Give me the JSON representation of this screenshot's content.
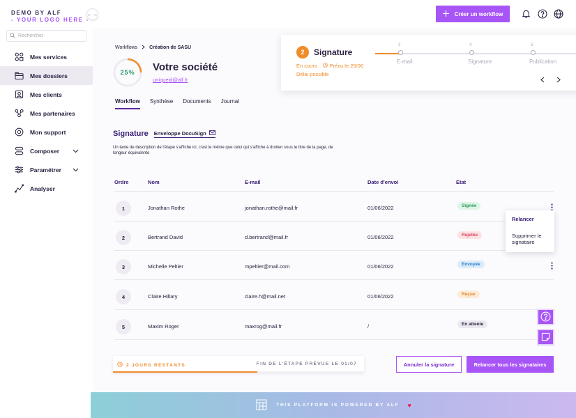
{
  "brand": {
    "line1": "DEMO BY ALF",
    "line2": "- YOUR LOGO HERE -",
    "collapse_label": "←→"
  },
  "search": {
    "placeholder": "Rechercher"
  },
  "sidebar": {
    "items": [
      {
        "label": "Mes services",
        "icon": "apps-icon"
      },
      {
        "label": "Mes dossiers",
        "icon": "folder-icon",
        "active": true
      },
      {
        "label": "Mes clients",
        "icon": "client-card-icon"
      },
      {
        "label": "Mes partenaires",
        "icon": "partners-icon"
      },
      {
        "label": "Mon support",
        "icon": "support-icon"
      },
      {
        "label": "Composer",
        "icon": "layers-icon",
        "expandable": true
      },
      {
        "label": "Paramétrer",
        "icon": "sliders-icon",
        "expandable": true
      },
      {
        "label": "Analyser",
        "icon": "analytics-icon"
      }
    ]
  },
  "topbar": {
    "create_label": "Créer un workflow"
  },
  "breadcrumb": {
    "root": "Workflows",
    "current": "Création de SASU"
  },
  "company": {
    "progress_label": "25%",
    "progress": 0.25,
    "name": "Votre société",
    "email": "uniqueid@alf.fr"
  },
  "tabs": [
    "Workflow",
    "Synthèse",
    "Documents",
    "Journal"
  ],
  "step": {
    "number": "2",
    "title": "Signature",
    "status": "En cours",
    "due": "Prévu le 25/06",
    "delay": "Délai possible",
    "timeline": [
      {
        "n": "3",
        "label": "E-mail"
      },
      {
        "n": "4",
        "label": "Signature"
      },
      {
        "n": "5",
        "label": "Publication"
      }
    ]
  },
  "signature": {
    "heading": "Signature",
    "envelope": "Enveloppe DocuSign",
    "description": "Un texte de description de l'étape s'affiche ici, c'est le même que celui qui s'affiche à droiten sous le titre de la page, de longeur équivalente"
  },
  "table": {
    "headers": {
      "ordre": "Ordre",
      "nom": "Nom",
      "email": "E-mail",
      "date": "Date d'envoi",
      "etat": "Etat"
    },
    "rows": [
      {
        "ordre": "1",
        "nom": "Jonathan Rothe",
        "email": "jonathan.rothe@mail.fr",
        "date": "01/06/2022",
        "etat": "Signée"
      },
      {
        "ordre": "2",
        "nom": "Bertrand David",
        "email": "d.bertrand@mail.fr",
        "date": "01/06/2022",
        "etat": "Rejetée"
      },
      {
        "ordre": "3",
        "nom": "Michelle Peltier",
        "email": "mpeltier@mail.com",
        "date": "01/06/2022",
        "etat": "Envoyée"
      },
      {
        "ordre": "4",
        "nom": "Claire Hillary",
        "email": "claire.h@mail.net",
        "date": "01/06/2022",
        "etat": "Reçue"
      },
      {
        "ordre": "5",
        "nom": "Maxim Roger",
        "email": "maxrog@mail.fr",
        "date": "/",
        "etat": "En attente"
      }
    ]
  },
  "popup": {
    "relancer": "Relancer",
    "supprimer": "Supprimer le signataire"
  },
  "bottom": {
    "days_left": "2 JOURS RESTANTS",
    "end_label": "FIN DE L'ÉTAPE PRÉVUE LE 01/07",
    "cancel": "Annuler la signature",
    "remind_all": "Relancer tous les signataires"
  },
  "footer": {
    "text": "THIS PLATFORM IS POWERED BY ALF"
  },
  "colors": {
    "accent": "#a855f7",
    "orange": "#f08c2a",
    "signee_bg": "#dff5e8",
    "signee_fg": "#2a9a5a",
    "rejetee_bg": "#fde3e6",
    "rejetee_fg": "#d8455a",
    "envoyee_bg": "#dcecfb",
    "envoyee_fg": "#2a7ac8",
    "recue_bg": "#fdebd8",
    "recue_fg": "#e08a2a",
    "attente_bg": "#ebe8f0",
    "attente_fg": "#2a2140"
  }
}
